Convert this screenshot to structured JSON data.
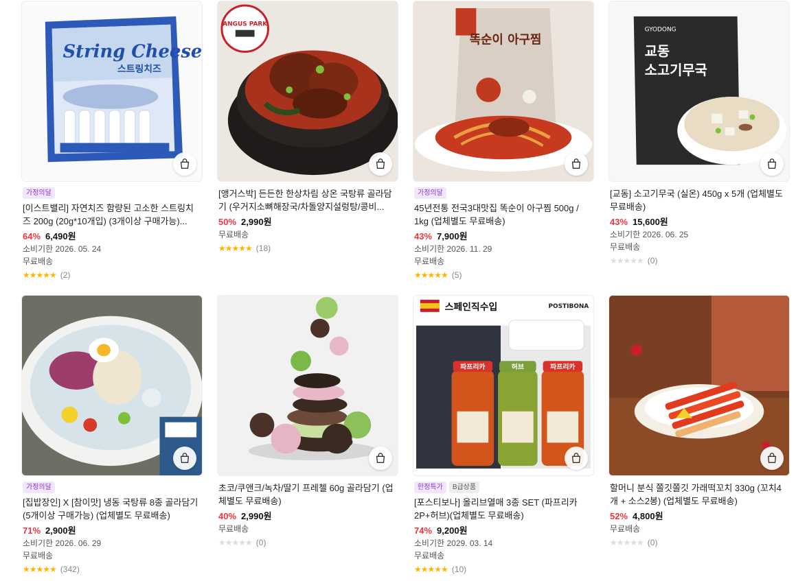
{
  "products": [
    {
      "image_icon": "string-cheese-package",
      "badges": [
        {
          "label": "가정의달",
          "style": "purple"
        }
      ],
      "title": "[이스트밸리] 자연치즈 함량된 고소한 스트링치즈 200g (20g*10개입) (3개이상 구매가능)...",
      "discount": "64%",
      "price": "6,490원",
      "expiry": "소비기한 2026. 05. 24",
      "shipping": "무료배송",
      "rating_stars": 5,
      "rating_count": "(2)"
    },
    {
      "image_icon": "braised-pork-stew",
      "badges": [],
      "title": "[앵거스박] 든든한 한상차림 상온 국탕류 골라담기 (우거지소뼈해장국/차돌양지설렁탕/콩비...",
      "discount": "50%",
      "price": "2,990원",
      "expiry": "",
      "shipping": "무료배송",
      "rating_stars": 5,
      "rating_count": "(18)"
    },
    {
      "image_icon": "monkfish-stew",
      "badges": [
        {
          "label": "가정의달",
          "style": "purple"
        }
      ],
      "title": "45년전통 전국3대맛집 똑순이 아구찜 500g / 1kg (업체별도 무료배송)",
      "discount": "43%",
      "price": "7,900원",
      "expiry": "소비기한 2026. 11. 29",
      "shipping": "무료배송",
      "rating_stars": 5,
      "rating_count": "(5)"
    },
    {
      "image_icon": "beef-radish-soup",
      "badges": [],
      "title": "[교동] 소고기무국 (실온) 450g x 5개 (업체별도 무료배송)",
      "discount": "43%",
      "price": "15,600원",
      "expiry": "소비기한 2026. 06. 25",
      "shipping": "무료배송",
      "rating_stars": 0,
      "rating_count": "(0)"
    },
    {
      "image_icon": "cold-noodle-soup",
      "badges": [
        {
          "label": "가정의달",
          "style": "purple"
        }
      ],
      "title": "[집밥장인] X [참이맛] 냉동 국탕류 8종 골라담기 (5개이상 구매가능) (업체별도 무료배송)",
      "discount": "71%",
      "price": "2,900원",
      "expiry": "소비기한 2026. 06. 29",
      "shipping": "무료배송",
      "rating_stars": 5,
      "rating_count": "(342)"
    },
    {
      "image_icon": "pretzel-stack",
      "badges": [],
      "title": "초코/쿠앤크/녹차/딸기 프레첼 60g 골라담기 (업체별도 무료배송)",
      "discount": "40%",
      "price": "2,990원",
      "expiry": "",
      "shipping": "무료배송",
      "rating_stars": 0,
      "rating_count": "(0)"
    },
    {
      "image_icon": "olive-jar-set",
      "badges": [
        {
          "label": "한정특가",
          "style": "purple"
        },
        {
          "label": "B급상품",
          "style": "gray"
        }
      ],
      "title": "[포스티보나] 올리브열매 3종 SET (파프리카2P+허브)(업체별도 무료배송)",
      "discount": "74%",
      "price": "9,200원",
      "expiry": "소비기한 2029. 03. 14",
      "shipping": "무료배송",
      "rating_stars": 5,
      "rating_count": "(10)"
    },
    {
      "image_icon": "rice-cake-skewers",
      "badges": [],
      "title": "할머니 분식 쫄깃쫄깃 가래떡꼬치 330g (꼬치4개 + 소스2봉) (업체별도 무료배송)",
      "discount": "52%",
      "price": "4,800원",
      "expiry": "",
      "shipping": "무료배송",
      "rating_stars": 0,
      "rating_count": "(0)"
    }
  ],
  "image_text": {
    "cheese_brand": "String Cheese",
    "cheese_kr": "스트링치즈",
    "angus_brand": "ANGUS PARK",
    "monkfish_brand": "똑순이 아구찜",
    "gyodong_brand": "GYODONG",
    "gyodong_title1": "교동",
    "gyodong_title2": "소고기무국",
    "olive_banner": "스페인직수입",
    "olive_brand": "POSTIBONA",
    "olive_label1": "파프리카",
    "olive_label2": "허브",
    "olive_label3": "파프리카"
  },
  "colors": {
    "discount": "#f0353f",
    "star": "#ffb400",
    "badge_purple": "#8a36d6"
  }
}
